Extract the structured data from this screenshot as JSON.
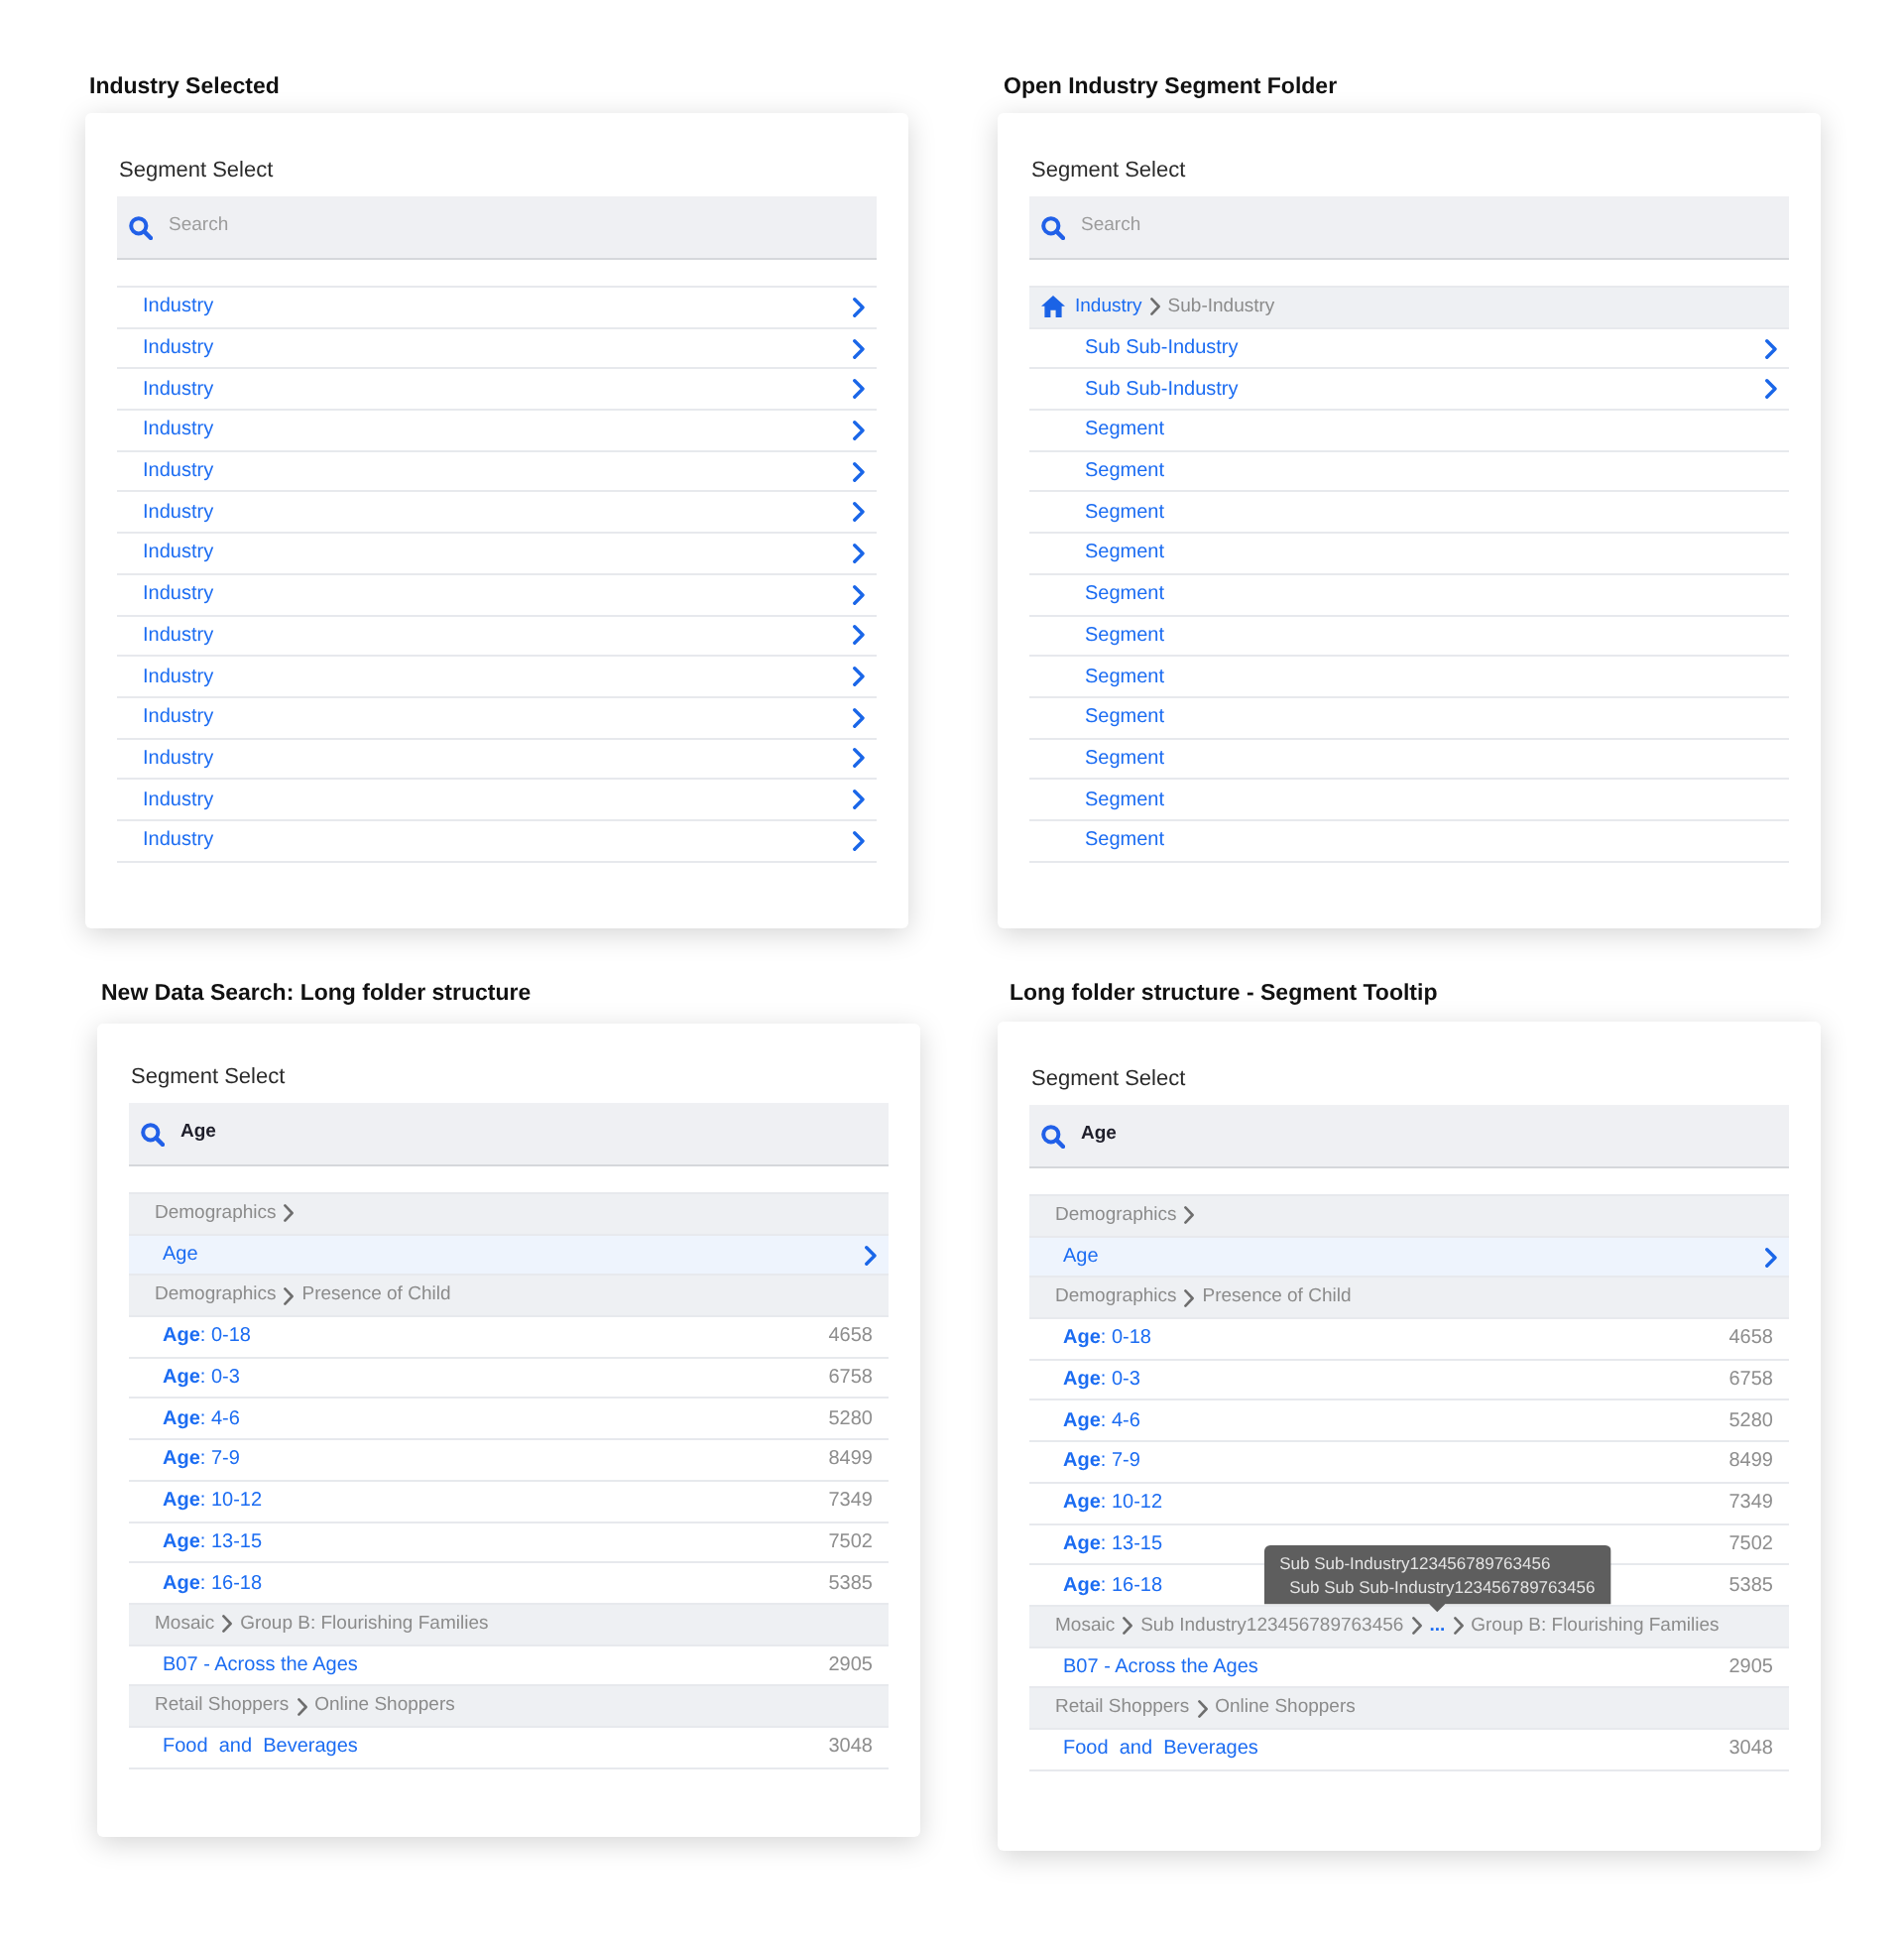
{
  "panels": [
    {
      "caption": "Industry Selected",
      "title": "Segment Select",
      "search": {
        "placeholder": "Search"
      },
      "rows": [
        {
          "kind": "folder",
          "label": "Industry",
          "selected": false
        },
        {
          "kind": "folder",
          "label": "Industry",
          "selected": false
        },
        {
          "kind": "folder",
          "label": "Industry",
          "selected": false
        },
        {
          "kind": "folder",
          "label": "Industry",
          "selected": false
        },
        {
          "kind": "folder",
          "label": "Industry",
          "selected": false
        },
        {
          "kind": "folder",
          "label": "Industry",
          "selected": false
        },
        {
          "kind": "folder",
          "label": "Industry",
          "selected": false
        },
        {
          "kind": "folder",
          "label": "Industry",
          "selected": false
        },
        {
          "kind": "folder",
          "label": "Industry",
          "selected": false
        },
        {
          "kind": "folder",
          "label": "Industry",
          "selected": false
        },
        {
          "kind": "folder",
          "label": "Industry",
          "selected": false
        },
        {
          "kind": "folder",
          "label": "Industry",
          "selected": false
        },
        {
          "kind": "folder",
          "label": "Industry",
          "selected": false
        },
        {
          "kind": "folder",
          "label": "Industry",
          "selected": false
        }
      ]
    },
    {
      "caption": "Open Industry Segment Folder",
      "title": "Segment Select",
      "search": {
        "placeholder": "Search"
      },
      "rows": [
        {
          "kind": "breadcrumb",
          "parts": [
            {
              "kind": "link",
              "label": "Industry"
            },
            {
              "kind": "text",
              "label": "Sub-Industry"
            }
          ],
          "children": [
            {
              "kind": "folder",
              "label": "Sub Sub-Industry",
              "selected": false
            },
            {
              "kind": "folder",
              "label": "Sub Sub-Industry",
              "selected": false
            },
            {
              "kind": "segment",
              "label": "Segment",
              "selected": false
            },
            {
              "kind": "segment",
              "label": "Segment",
              "selected": false
            },
            {
              "kind": "segment",
              "label": "Segment",
              "selected": false
            },
            {
              "kind": "segment",
              "label": "Segment",
              "selected": false
            },
            {
              "kind": "segment",
              "label": "Segment",
              "selected": false
            },
            {
              "kind": "segment",
              "label": "Segment",
              "selected": false
            },
            {
              "kind": "segment",
              "label": "Segment",
              "selected": false
            },
            {
              "kind": "segment",
              "label": "Segment",
              "selected": false
            },
            {
              "kind": "segment",
              "label": "Segment",
              "selected": false
            },
            {
              "kind": "segment",
              "label": "Segment",
              "selected": false
            },
            {
              "kind": "segment",
              "label": "Segment",
              "selected": false
            }
          ]
        }
      ]
    },
    {
      "caption": "New Data Search: Long folder structure",
      "title": "Segment Select",
      "search": {
        "value": "Age"
      },
      "rows": [
        {
          "kind": "path",
          "parts": [
            {
              "kind": "text",
              "label": "Demographics"
            }
          ],
          "trailing_chevron": true,
          "children": [
            {
              "kind": "folder",
              "label": "Age",
              "selected": true
            }
          ]
        },
        {
          "kind": "path",
          "parts": [
            {
              "kind": "text",
              "label": "Demographics"
            },
            {
              "kind": "text",
              "label": "Presence of Child"
            }
          ],
          "children": [
            {
              "kind": "segment",
              "label": "**Age**: 0-18",
              "count": "4658",
              "selected": false
            },
            {
              "kind": "segment",
              "label": "**Age**: 0-3",
              "count": "6758",
              "selected": false
            },
            {
              "kind": "segment",
              "label": "**Age**: 4-6",
              "count": "5280",
              "selected": false
            },
            {
              "kind": "segment",
              "label": "**Age**: 7-9",
              "count": "8499",
              "selected": false
            },
            {
              "kind": "segment",
              "label": "**Age**: 10-12",
              "count": "7349",
              "selected": false
            },
            {
              "kind": "segment",
              "label": "**Age**: 13-15",
              "count": "7502",
              "selected": false
            },
            {
              "kind": "segment",
              "label": "**Age**: 16-18",
              "count": "5385",
              "selected": false
            }
          ]
        },
        {
          "kind": "path",
          "parts": [
            {
              "kind": "text",
              "label": "Mosaic"
            },
            {
              "kind": "text",
              "label": "Group B: Flourishing Families"
            }
          ],
          "children": [
            {
              "kind": "segment",
              "label": "B07 - Across the Ages",
              "count": "2905",
              "selected": false
            }
          ]
        },
        {
          "kind": "path",
          "parts": [
            {
              "kind": "text",
              "label": "Retail Shoppers"
            },
            {
              "kind": "text",
              "label": "Online Shoppers"
            }
          ],
          "children": [
            {
              "kind": "segment",
              "label": "Food  and  Beverages",
              "count": "3048",
              "selected": false
            }
          ]
        }
      ]
    },
    {
      "caption": "Long folder structure - Segment Tooltip",
      "title": "Segment Select",
      "search": {
        "value": "Age"
      },
      "rows": [
        {
          "kind": "path",
          "parts": [
            {
              "kind": "text",
              "label": "Demographics"
            }
          ],
          "trailing_chevron": true,
          "children": [
            {
              "kind": "folder",
              "label": "Age",
              "selected": true
            }
          ]
        },
        {
          "kind": "path",
          "parts": [
            {
              "kind": "text",
              "label": "Demographics"
            },
            {
              "kind": "text",
              "label": "Presence of Child"
            }
          ],
          "children": [
            {
              "kind": "segment",
              "label": "**Age**: 0-18",
              "count": "4658",
              "selected": false
            },
            {
              "kind": "segment",
              "label": "**Age**: 0-3",
              "count": "6758",
              "selected": false
            },
            {
              "kind": "segment",
              "label": "**Age**: 4-6",
              "count": "5280",
              "selected": false
            },
            {
              "kind": "segment",
              "label": "**Age**: 7-9",
              "count": "8499",
              "selected": false
            },
            {
              "kind": "segment",
              "label": "**Age**: 10-12",
              "count": "7349",
              "selected": false
            },
            {
              "kind": "segment",
              "label": "**Age**: 13-15",
              "count": "7502",
              "selected": false
            },
            {
              "kind": "segment",
              "label": "**Age**: 16-18",
              "count": "5385",
              "selected": false
            }
          ]
        },
        {
          "kind": "path",
          "parts": [
            {
              "kind": "text",
              "label": "Mosaic"
            },
            {
              "kind": "text",
              "label": "Sub Industry123456789763456"
            },
            {
              "kind": "ellipsis",
              "label": "...",
              "tooltip": [
                "Sub Sub-Industry123456789763456",
                "Sub Sub Sub-Industry123456789763456"
              ]
            },
            {
              "kind": "text",
              "label": "Group B: Flourishing Families"
            }
          ],
          "children": [
            {
              "kind": "segment",
              "label": "B07 - Across the Ages",
              "count": "2905",
              "selected": false
            }
          ]
        },
        {
          "kind": "path",
          "parts": [
            {
              "kind": "text",
              "label": "Retail Shoppers"
            },
            {
              "kind": "text",
              "label": "Online Shoppers"
            }
          ],
          "children": [
            {
              "kind": "segment",
              "label": "Food  and  Beverages",
              "count": "3048",
              "selected": false
            }
          ]
        }
      ]
    }
  ]
}
